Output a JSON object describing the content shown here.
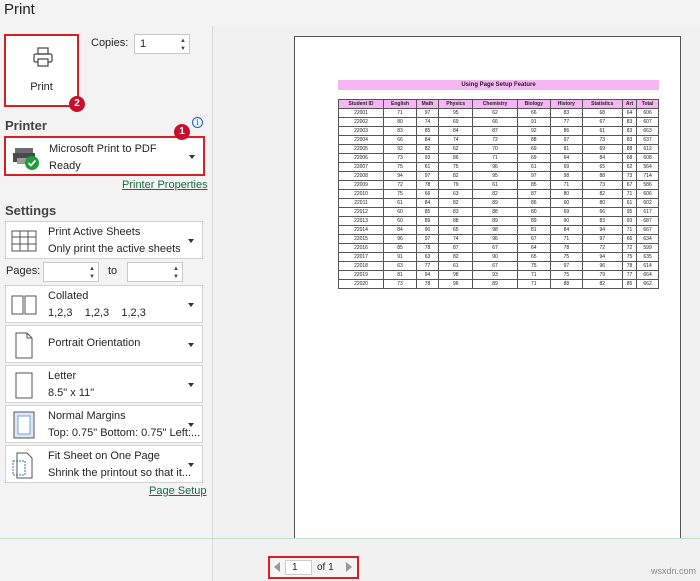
{
  "header": {
    "title": "Print"
  },
  "print_button": {
    "label": "Print",
    "badge": "2"
  },
  "copies": {
    "label": "Copies:",
    "value": "1"
  },
  "printer": {
    "section_label": "Printer",
    "info_icon": "i",
    "name": "Microsoft Print to PDF",
    "status": "Ready",
    "badge": "1",
    "properties_link": "Printer Properties"
  },
  "settings": {
    "section_label": "Settings",
    "print_what": {
      "title": "Print Active Sheets",
      "subtitle": "Only print the active sheets"
    },
    "pages": {
      "label": "Pages:",
      "to_label": "to",
      "from_value": "",
      "to_value": ""
    },
    "collation": {
      "title": "Collated",
      "subtitle": "1,2,3    1,2,3    1,2,3"
    },
    "orientation": {
      "title": "Portrait Orientation"
    },
    "paper": {
      "title": "Letter",
      "subtitle": "8.5\" x 11\""
    },
    "margins": {
      "title": "Normal Margins",
      "subtitle": "Top: 0.75\" Bottom: 0.75\" Left:..."
    },
    "scaling": {
      "title": "Fit Sheet on One Page",
      "subtitle": "Shrink the printout so that it..."
    },
    "page_setup_link": "Page Setup"
  },
  "preview": {
    "sheet_title": "Using Page Setup Feature",
    "columns": [
      "Student ID",
      "English",
      "Math",
      "Physics",
      "Chemistry",
      "Biology",
      "History",
      "Statistics",
      "Art",
      "Total"
    ],
    "rows": [
      [
        "22001",
        "71",
        "97",
        "95",
        "62",
        "66",
        "83",
        "68",
        "64",
        "606"
      ],
      [
        "22002",
        "80",
        "74",
        "69",
        "66",
        "91",
        "77",
        "67",
        "83",
        "607"
      ],
      [
        "22003",
        "83",
        "85",
        "84",
        "87",
        "92",
        "86",
        "61",
        "83",
        "663"
      ],
      [
        "22004",
        "66",
        "84",
        "74",
        "72",
        "88",
        "97",
        "73",
        "83",
        "637"
      ],
      [
        "22005",
        "92",
        "82",
        "62",
        "70",
        "69",
        "81",
        "69",
        "88",
        "612"
      ],
      [
        "22006",
        "73",
        "93",
        "86",
        "71",
        "69",
        "64",
        "84",
        "68",
        "608"
      ],
      [
        "22007",
        "75",
        "61",
        "75",
        "96",
        "61",
        "69",
        "65",
        "62",
        "564"
      ],
      [
        "22008",
        "94",
        "97",
        "82",
        "95",
        "97",
        "98",
        "88",
        "73",
        "714"
      ],
      [
        "22009",
        "72",
        "78",
        "79",
        "61",
        "85",
        "71",
        "73",
        "67",
        "586"
      ],
      [
        "22010",
        "75",
        "66",
        "63",
        "82",
        "87",
        "80",
        "82",
        "71",
        "606"
      ],
      [
        "22011",
        "61",
        "84",
        "82",
        "89",
        "86",
        "60",
        "80",
        "61",
        "602"
      ],
      [
        "22012",
        "60",
        "85",
        "83",
        "88",
        "80",
        "69",
        "66",
        "95",
        "617"
      ],
      [
        "22013",
        "60",
        "89",
        "88",
        "89",
        "89",
        "90",
        "83",
        "93",
        "687"
      ],
      [
        "22014",
        "84",
        "90",
        "65",
        "98",
        "81",
        "84",
        "94",
        "71",
        "667"
      ],
      [
        "22015",
        "96",
        "97",
        "74",
        "96",
        "67",
        "71",
        "97",
        "66",
        "634"
      ],
      [
        "22016",
        "85",
        "78",
        "87",
        "67",
        "64",
        "78",
        "72",
        "72",
        "599"
      ],
      [
        "22017",
        "91",
        "63",
        "82",
        "90",
        "65",
        "75",
        "94",
        "75",
        "635"
      ],
      [
        "22018",
        "63",
        "77",
        "61",
        "67",
        "75",
        "97",
        "96",
        "78",
        "614"
      ],
      [
        "22019",
        "81",
        "94",
        "98",
        "93",
        "71",
        "75",
        "79",
        "77",
        "664"
      ],
      [
        "22020",
        "73",
        "78",
        "96",
        "89",
        "71",
        "88",
        "82",
        "85",
        "662"
      ]
    ]
  },
  "pager": {
    "current": "1",
    "total_label": "of 1"
  },
  "watermark": "wsxdn.com",
  "colors": {
    "highlight_border": "#d62027",
    "badge": "#c8102e",
    "header_fill": "#f5b6f3",
    "link": "#1d6b40"
  }
}
